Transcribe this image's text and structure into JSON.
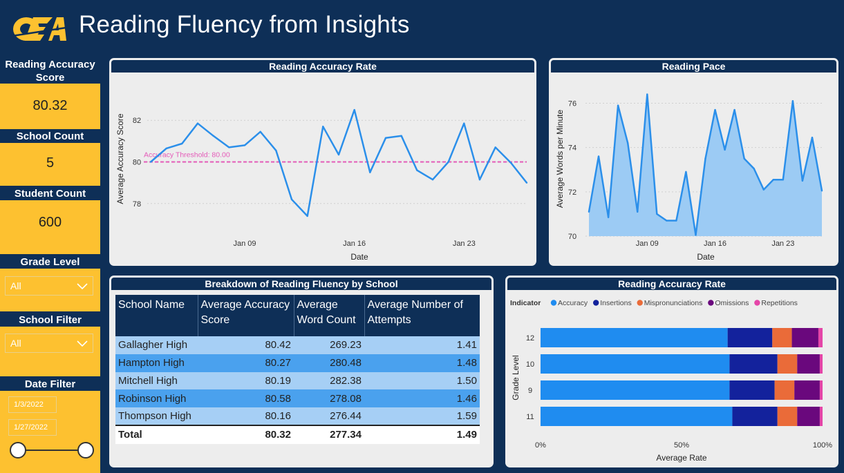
{
  "header": {
    "logo_text": "OEA",
    "title": "Reading Fluency from Insights"
  },
  "sidebar": {
    "accuracy_label": "Reading Accuracy Score",
    "accuracy_value": "80.32",
    "school_count_label": "School Count",
    "school_count_value": "5",
    "student_count_label": "Student Count",
    "student_count_value": "600",
    "grade_level_label": "Grade Level",
    "grade_level_value": "All",
    "school_filter_label": "School Filter",
    "school_filter_value": "All",
    "date_filter_label": "Date Filter",
    "date_start": "1/3/2022",
    "date_end": "1/27/2022"
  },
  "colors": {
    "navy": "#0e2f57",
    "gold": "#fdc130",
    "line_blue": "#2b8fea",
    "area_fill": "#9ccbf4",
    "threshold_pink": "#e45ab8"
  },
  "panels": {
    "accuracy_rate_title": "Reading Accuracy Rate",
    "pace_title": "Reading Pace",
    "breakdown_title": "Breakdown of Reading Fluency by School",
    "stacked_title": "Reading Accuracy Rate"
  },
  "table": {
    "headers": [
      "School Name",
      "Average Accuracy Score",
      "Average Word Count",
      "Average Number of Attempts"
    ],
    "rows": [
      [
        "Gallagher High",
        "80.42",
        "269.23",
        "1.41"
      ],
      [
        "Hampton High",
        "80.27",
        "280.48",
        "1.48"
      ],
      [
        "Mitchell High",
        "80.19",
        "282.38",
        "1.50"
      ],
      [
        "Robinson High",
        "80.58",
        "278.08",
        "1.46"
      ],
      [
        "Thompson High",
        "80.16",
        "276.44",
        "1.59"
      ]
    ],
    "total": [
      "Total",
      "80.32",
      "277.34",
      "1.49"
    ]
  },
  "chart_data": [
    {
      "type": "line",
      "title": "Reading Accuracy Rate",
      "xlabel": "Date",
      "ylabel": "Average Accuracy Score",
      "x_ticks": [
        "Jan 09",
        "Jan 16",
        "Jan 23"
      ],
      "y_ticks": [
        78,
        80,
        82
      ],
      "ylim": [
        76.7,
        83.5
      ],
      "threshold": {
        "label": "Accuracy Threshold: 80.00",
        "value": 80
      },
      "x": [
        "2022-01-03",
        "2022-01-04",
        "2022-01-05",
        "2022-01-06",
        "2022-01-07",
        "2022-01-08",
        "2022-01-09",
        "2022-01-10",
        "2022-01-11",
        "2022-01-12",
        "2022-01-13",
        "2022-01-14",
        "2022-01-15",
        "2022-01-16",
        "2022-01-17",
        "2022-01-18",
        "2022-01-19",
        "2022-01-20",
        "2022-01-21",
        "2022-01-22",
        "2022-01-23",
        "2022-01-24",
        "2022-01-25",
        "2022-01-26",
        "2022-01-27"
      ],
      "values": [
        80.0,
        80.65,
        80.88,
        81.85,
        81.25,
        80.7,
        80.8,
        81.45,
        80.55,
        78.2,
        77.4,
        81.7,
        80.35,
        82.5,
        79.5,
        81.15,
        81.25,
        79.6,
        79.15,
        80.0,
        81.85,
        79.15,
        80.7,
        79.95,
        79.0
      ],
      "grid": true
    },
    {
      "type": "area",
      "title": "Reading Pace",
      "xlabel": "Date",
      "ylabel": "Average Words per Minute",
      "x_ticks": [
        "Jan 09",
        "Jan 16",
        "Jan 23"
      ],
      "y_ticks": [
        70,
        72,
        74,
        76
      ],
      "ylim": [
        70,
        76.7
      ],
      "x": [
        "2022-01-03",
        "2022-01-04",
        "2022-01-05",
        "2022-01-06",
        "2022-01-07",
        "2022-01-08",
        "2022-01-09",
        "2022-01-10",
        "2022-01-11",
        "2022-01-12",
        "2022-01-13",
        "2022-01-14",
        "2022-01-15",
        "2022-01-16",
        "2022-01-17",
        "2022-01-18",
        "2022-01-19",
        "2022-01-20",
        "2022-01-21",
        "2022-01-22",
        "2022-01-23",
        "2022-01-24",
        "2022-01-25",
        "2022-01-26",
        "2022-01-27"
      ],
      "values": [
        71.1,
        73.6,
        70.85,
        75.9,
        74.2,
        71.1,
        76.4,
        71.0,
        70.7,
        70.7,
        72.9,
        70.05,
        73.5,
        75.7,
        73.9,
        75.7,
        73.5,
        73.05,
        72.1,
        72.55,
        72.55,
        76.1,
        72.5,
        74.45,
        72.05
      ],
      "grid": true
    },
    {
      "type": "bar",
      "orientation": "horizontal-stacked-100",
      "title": "Reading Accuracy Rate",
      "legend_title": "Indicator",
      "legend_position": "top-left",
      "xlabel": "Average Rate",
      "ylabel": "Grade Level",
      "x_ticks": [
        "0%",
        "50%",
        "100%"
      ],
      "categories": [
        "12",
        "10",
        "9",
        "11"
      ],
      "series": [
        {
          "name": "Accuracy",
          "color": "#1f8cf0",
          "values": [
            67.0,
            67.0,
            67.0,
            68.0
          ]
        },
        {
          "name": "Insertions",
          "color": "#13229c",
          "values": [
            16.0,
            17.0,
            16.0,
            16.0
          ]
        },
        {
          "name": "Mispronunciations",
          "color": "#ea6b39",
          "values": [
            7.0,
            7.0,
            7.0,
            7.0
          ]
        },
        {
          "name": "Omissions",
          "color": "#6a087d",
          "values": [
            9.5,
            8.0,
            9.0,
            8.0
          ]
        },
        {
          "name": "Repetitions",
          "color": "#e546a8",
          "values": [
            1.5,
            1.0,
            1.0,
            1.0
          ]
        }
      ]
    }
  ]
}
